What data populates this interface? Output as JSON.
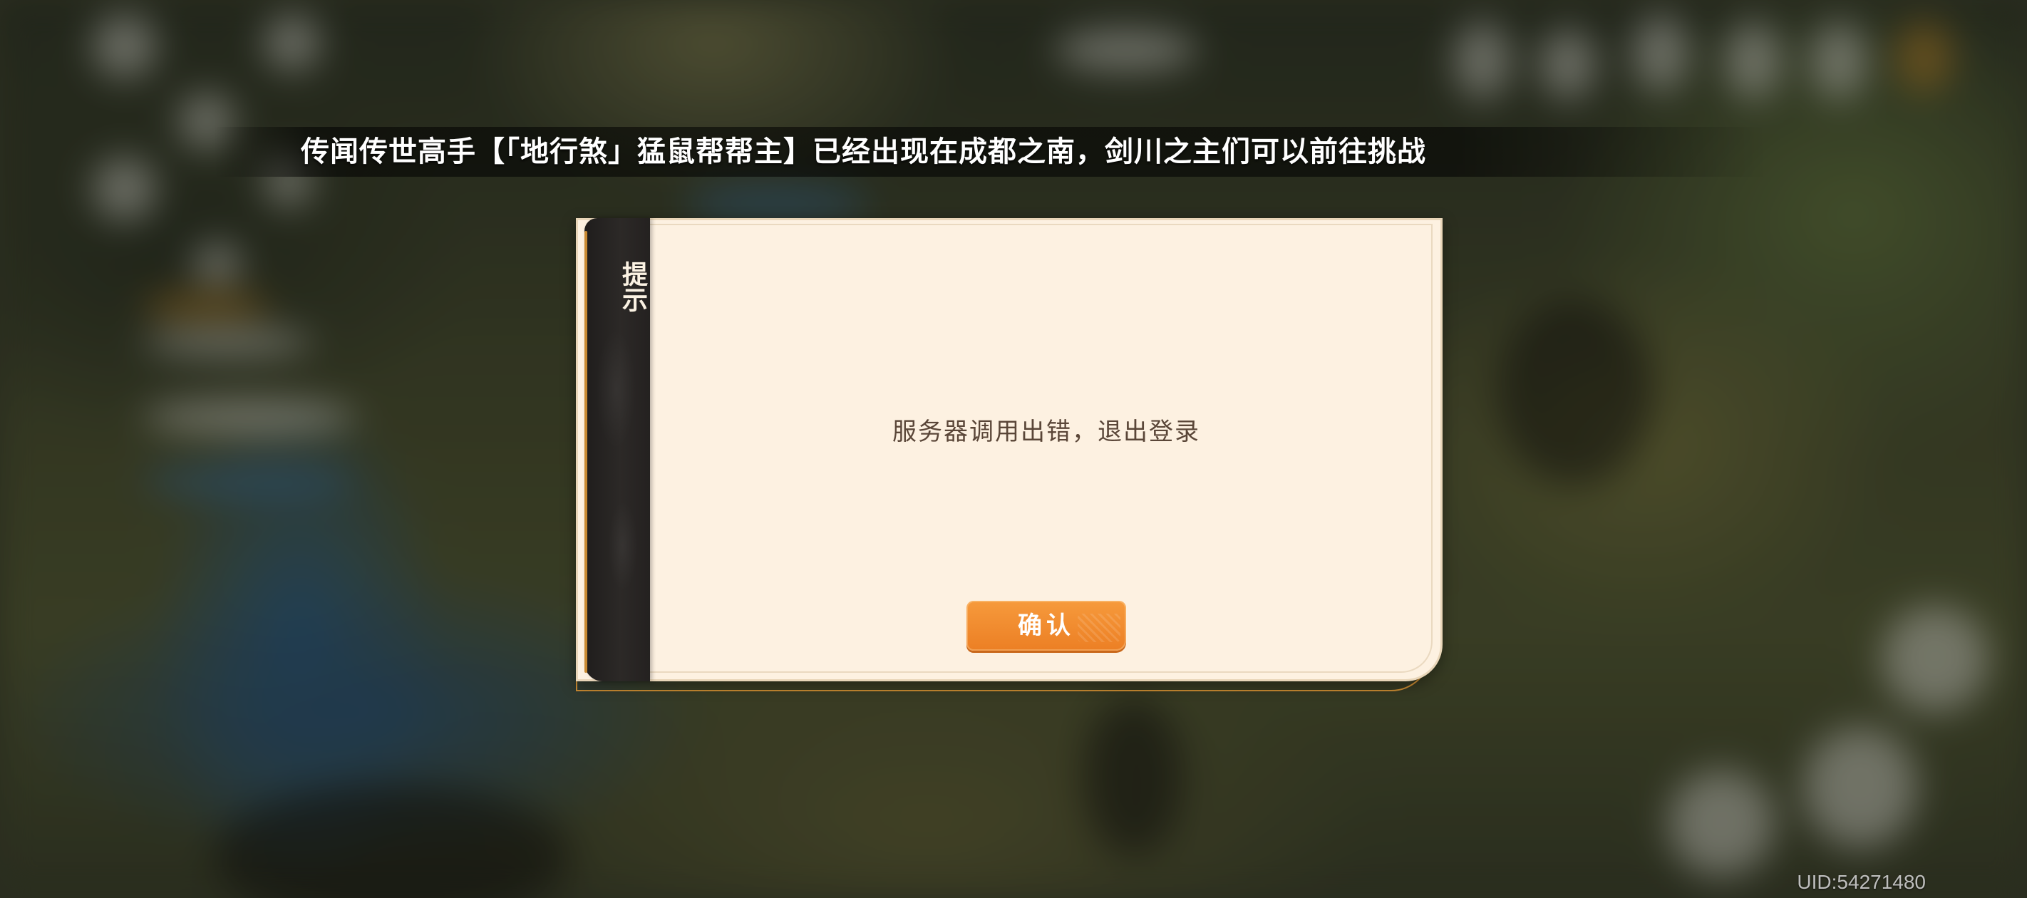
{
  "broadcast": {
    "text": "传闻传世高手【「地行煞」猛鼠帮帮主】已经出现在成都之南，剑川之主们可以前往挑战"
  },
  "dialog": {
    "title": "提示",
    "message": "服务器调用出错，退出登录",
    "confirm_label": "确认"
  },
  "footer": {
    "uid": "UID:54271480"
  },
  "colors": {
    "dialog_background": "#fdf1e1",
    "side_tab": "#2c2927",
    "confirm_button": "#ec7f24",
    "message_text": "#5a4638"
  }
}
